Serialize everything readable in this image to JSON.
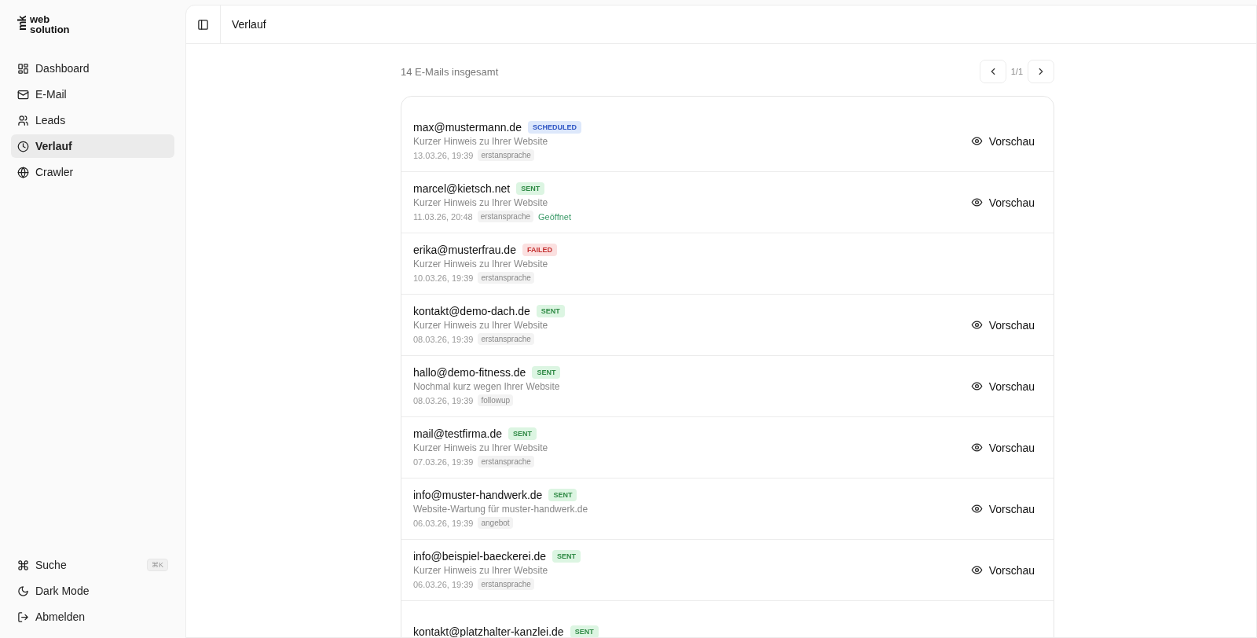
{
  "logo": {
    "mark": "mk",
    "line_1": "web",
    "line_2": "solution"
  },
  "sidebar": {
    "items": [
      {
        "label": "Dashboard",
        "selected": false
      },
      {
        "label": "E-Mail",
        "selected": false
      },
      {
        "label": "Leads",
        "selected": false
      },
      {
        "label": "Verlauf",
        "selected": true
      },
      {
        "label": "Crawler",
        "selected": false
      }
    ],
    "bottom_items": [
      {
        "label": "Suche",
        "shortcut": "⌘K"
      },
      {
        "label": "Dark Mode"
      },
      {
        "label": "Abmelden"
      }
    ]
  },
  "header": {
    "title": "Verlauf"
  },
  "summary": "14 E-Mails insgesamt",
  "pagination": {
    "page": "1/1"
  },
  "emails": [
    {
      "address": "max@mustermann.de",
      "status": {
        "label": "SCHEDULED",
        "kind": "scheduled"
      },
      "subject": "Kurzer Hinweis zu Ihrer Website",
      "date": "13.03.26, 19:39",
      "tag": "erstansprache",
      "action": "Vorschau"
    },
    {
      "address": "marcel@kietsch.net",
      "status": {
        "label": "SENT",
        "kind": "sent"
      },
      "subject": "Kurzer Hinweis zu Ihrer Website",
      "date": "11.03.26, 20:48",
      "tag": "erstansprache",
      "opened": "Geöffnet",
      "action": "Vorschau"
    },
    {
      "address": "erika@musterfrau.de",
      "status": {
        "label": "FAILED",
        "kind": "failed"
      },
      "subject": "Kurzer Hinweis zu Ihrer Website",
      "date": "10.03.26, 19:39",
      "tag": "erstansprache"
    },
    {
      "address": "kontakt@demo-dach.de",
      "status": {
        "label": "SENT",
        "kind": "sent"
      },
      "subject": "Kurzer Hinweis zu Ihrer Website",
      "date": "08.03.26, 19:39",
      "tag": "erstansprache",
      "action": "Vorschau"
    },
    {
      "address": "hallo@demo-fitness.de",
      "status": {
        "label": "SENT",
        "kind": "sent"
      },
      "subject": "Nochmal kurz wegen Ihrer Website",
      "date": "08.03.26, 19:39",
      "tag": "followup",
      "action": "Vorschau"
    },
    {
      "address": "mail@testfirma.de",
      "status": {
        "label": "SENT",
        "kind": "sent"
      },
      "subject": "Kurzer Hinweis zu Ihrer Website",
      "date": "07.03.26, 19:39",
      "tag": "erstansprache",
      "action": "Vorschau"
    },
    {
      "address": "info@muster-handwerk.de",
      "status": {
        "label": "SENT",
        "kind": "sent"
      },
      "subject": "Website-Wartung für muster-handwerk.de",
      "date": "06.03.26, 19:39",
      "tag": "angebot",
      "action": "Vorschau"
    },
    {
      "address": "info@beispiel-baeckerei.de",
      "status": {
        "label": "SENT",
        "kind": "sent"
      },
      "subject": "Kurzer Hinweis zu Ihrer Website",
      "date": "06.03.26, 19:39",
      "tag": "erstansprache",
      "action": "Vorschau"
    },
    {
      "address": "kontakt@platzhalter-kanzlei.de",
      "status": {
        "label": "SENT",
        "kind": "sent"
      }
    }
  ]
}
